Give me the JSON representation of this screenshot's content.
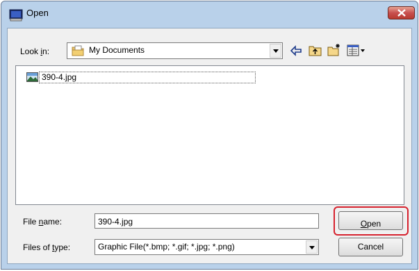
{
  "window": {
    "title": "Open",
    "accent": "#b9d1ea",
    "close_color": "#c75050"
  },
  "lookin": {
    "label_pre": "Look ",
    "label_u": "i",
    "label_post": "n:",
    "value": "My Documents"
  },
  "toolbar": {
    "icons": [
      "back-arrow-icon",
      "up-folder-icon",
      "new-folder-icon",
      "view-menu-icon"
    ]
  },
  "files": [
    {
      "name": "390-4.jpg",
      "icon": "image-file-icon",
      "selected": true
    }
  ],
  "filename": {
    "label_pre": "File ",
    "label_u": "n",
    "label_post": "ame:",
    "value": "390-4.jpg"
  },
  "filetype": {
    "label_pre": "Files of ",
    "label_u": "t",
    "label_post": "ype:",
    "value": "Graphic File(*.bmp; *.gif; *.jpg; *.png)"
  },
  "buttons": {
    "open_u": "O",
    "open_rest": "pen",
    "cancel": "Cancel",
    "highlight_color": "#d6222e"
  }
}
